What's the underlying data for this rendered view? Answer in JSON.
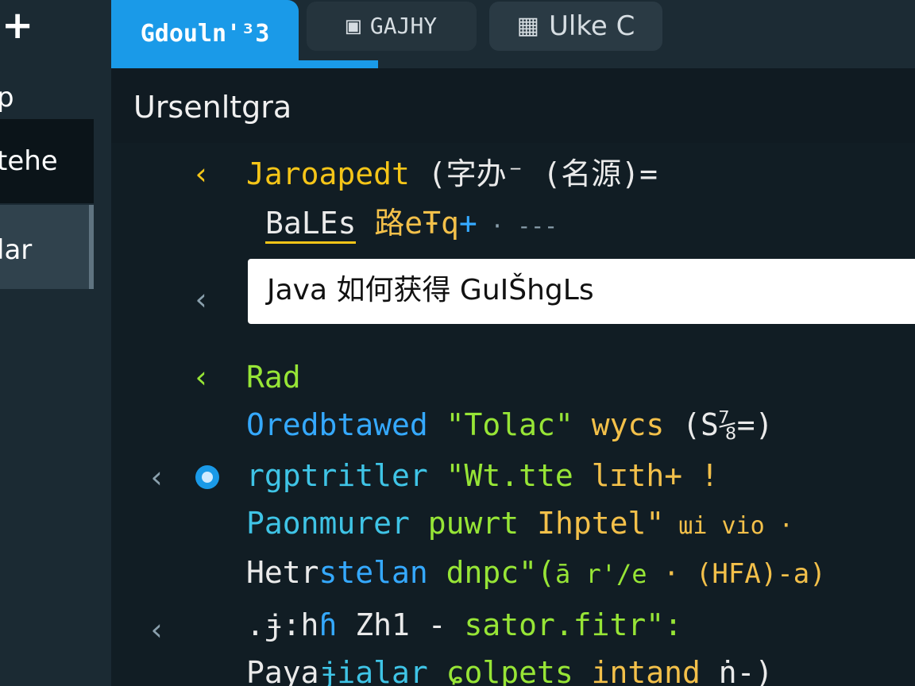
{
  "sidebar": {
    "add_icon": "plus-icon",
    "add_glyph": "+",
    "items": [
      {
        "label": "p"
      },
      {
        "label": "tehe"
      },
      {
        "label": "lar"
      }
    ]
  },
  "tabs": [
    {
      "label": "Gdouln'³3",
      "active": true
    },
    {
      "label": "GAJHY",
      "icon": "window-icon",
      "glyph": "▣"
    },
    {
      "label": "Ulke C",
      "icon": "grid-icon",
      "glyph": "▦"
    }
  ],
  "header": {
    "title": "Ursenltgra"
  },
  "editor": {
    "lines": [
      {
        "caret": "‹",
        "parts": [
          "Jaroapedt",
          " (字办⁻ (名源)="
        ]
      },
      {
        "parts": [
          "BaLEs",
          " 路eŦq",
          "+",
          " · ---"
        ]
      },
      {
        "caret": "‹"
      },
      {
        "caret": "‹",
        "parts": [
          "Rad"
        ]
      },
      {
        "parts": [
          "Oredbtawed",
          " \"Tolac\"",
          " wycs",
          " (S⅞=)"
        ]
      },
      {
        "caret": "‹",
        "parts": [
          "rgptritler",
          " \"Wt.tte",
          " lɪth+ !"
        ]
      },
      {
        "parts": [
          "Paonmurer",
          " puwrt",
          " Ihptel\"",
          " ɯi vio ·"
        ]
      },
      {
        "parts": [
          "Hetr",
          "stelan",
          " dnpc\"(",
          "ā r'/e",
          " · (HFA)-a)"
        ]
      },
      {
        "caret": "‹",
        "parts": [
          ".ɉ:h",
          "ɦ",
          " Zh1 -",
          " sator.fitr\":"
        ]
      },
      {
        "parts": [
          "Paya",
          "ɉialar",
          " ɕolpets",
          " intand",
          " ṅ-)"
        ]
      }
    ]
  },
  "findbar": {
    "text": "Java  如何获得  GuIŠhgLs"
  },
  "colors": {
    "accent": "#1a9ae8",
    "keyword_yellow": "#f5c518",
    "keyword_green": "#97e536",
    "keyword_blue": "#35a9ff"
  }
}
